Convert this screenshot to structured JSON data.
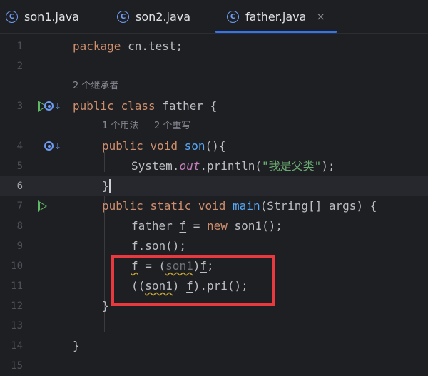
{
  "tabs": [
    {
      "label": "son1.java",
      "icon": "class-c-icon",
      "active": false
    },
    {
      "label": "son2.java",
      "icon": "class-c-icon",
      "active": false
    },
    {
      "label": "father.java",
      "icon": "class-c-icon",
      "active": true
    }
  ],
  "close_glyph": "×",
  "class_icon_letter": "C",
  "line_numbers": [
    "1",
    "2",
    "3",
    "4",
    "5",
    "6",
    "7",
    "8",
    "9",
    "10",
    "11",
    "12",
    "13",
    "14",
    "15"
  ],
  "current_line": "6",
  "hints": {
    "inheritors": "2 个继承者",
    "usages": "1 个用法",
    "overrides": "2 个重写"
  },
  "code": {
    "l1": {
      "kw": "package",
      "rest": " cn.test;"
    },
    "l3": {
      "kw1": "public",
      "kw2": "class",
      "rest": " father {"
    },
    "l4": {
      "kw1": "public",
      "kw2": "void",
      "fn": "son",
      "rest": "(){"
    },
    "l5": {
      "obj": "System.",
      "field": "out",
      "call": ".println(",
      "str": "\"我是父类\"",
      "end": ");"
    },
    "l6": {
      "text": "}"
    },
    "l7": {
      "kw1": "public",
      "kw2": "static",
      "kw3": "void",
      "fn": "main",
      "rest": "(String[] args) {"
    },
    "l8": {
      "type": "father ",
      "var": "f",
      "eq": " = ",
      "kw": "new",
      "rest": " son1();"
    },
    "l9": {
      "text": "f.son();"
    },
    "l10": {
      "var": "f",
      "eq": " = (",
      "cast": "son1",
      "close": ")",
      "var2": "f",
      "end": ";"
    },
    "l11": {
      "open": "((",
      "cast": "son1",
      "mid": ") ",
      "var": "f",
      "end": ").pri();"
    },
    "l12": {
      "text": "}"
    },
    "l14": {
      "text": "}"
    }
  },
  "colors": {
    "background": "#1e1f22",
    "keyword": "#cf8e6d",
    "function": "#56a8f5",
    "string": "#6aab73",
    "static_field": "#c77dbb",
    "highlight_box": "#e8393f",
    "tab_accent": "#3574f0"
  }
}
